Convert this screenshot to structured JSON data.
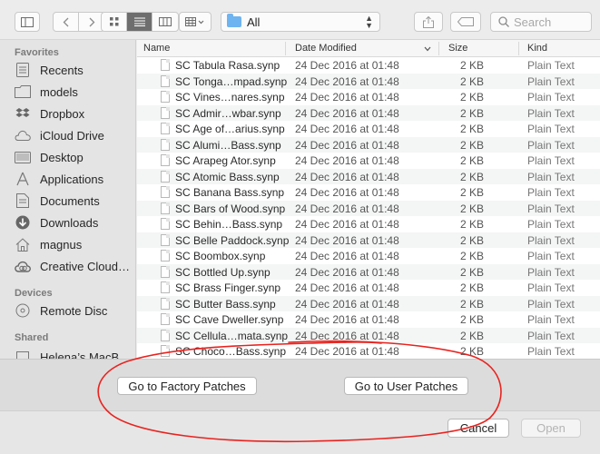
{
  "toolbar": {
    "location": "All",
    "search_placeholder": "Search"
  },
  "sidebar": {
    "sections": [
      {
        "heading": "Favorites"
      },
      {
        "heading": "Devices"
      },
      {
        "heading": "Shared"
      }
    ],
    "favorites": [
      {
        "label": "Recents",
        "icon": "recents-icon"
      },
      {
        "label": "models",
        "icon": "folder-icon"
      },
      {
        "label": "Dropbox",
        "icon": "dropbox-icon"
      },
      {
        "label": "iCloud Drive",
        "icon": "cloud-icon"
      },
      {
        "label": "Desktop",
        "icon": "desktop-icon"
      },
      {
        "label": "Applications",
        "icon": "applications-icon"
      },
      {
        "label": "Documents",
        "icon": "documents-icon"
      },
      {
        "label": "Downloads",
        "icon": "downloads-icon"
      },
      {
        "label": "magnus",
        "icon": "home-icon"
      },
      {
        "label": "Creative Cloud…",
        "icon": "creative-cloud-icon"
      }
    ],
    "devices": [
      {
        "label": "Remote Disc",
        "icon": "disc-icon"
      }
    ],
    "shared": [
      {
        "label": "Helena’s MacB…",
        "icon": "computer-icon"
      }
    ]
  },
  "columns": {
    "name": "Name",
    "date": "Date Modified",
    "size": "Size",
    "kind": "Kind"
  },
  "files": [
    {
      "name": "SC Tabula Rasa.synp",
      "date": "24 Dec 2016 at 01:48",
      "size": "2 KB",
      "kind": "Plain Text"
    },
    {
      "name": "SC Tonga…mpad.synp",
      "date": "24 Dec 2016 at 01:48",
      "size": "2 KB",
      "kind": "Plain Text"
    },
    {
      "name": "SC Vines…nares.synp",
      "date": "24 Dec 2016 at 01:48",
      "size": "2 KB",
      "kind": "Plain Text"
    },
    {
      "name": "SC Admir…wbar.synp",
      "date": "24 Dec 2016 at 01:48",
      "size": "2 KB",
      "kind": "Plain Text"
    },
    {
      "name": "SC Age of…arius.synp",
      "date": "24 Dec 2016 at 01:48",
      "size": "2 KB",
      "kind": "Plain Text"
    },
    {
      "name": "SC Alumi…Bass.synp",
      "date": "24 Dec 2016 at 01:48",
      "size": "2 KB",
      "kind": "Plain Text"
    },
    {
      "name": "SC Arapeg Ator.synp",
      "date": "24 Dec 2016 at 01:48",
      "size": "2 KB",
      "kind": "Plain Text"
    },
    {
      "name": "SC Atomic Bass.synp",
      "date": "24 Dec 2016 at 01:48",
      "size": "2 KB",
      "kind": "Plain Text"
    },
    {
      "name": "SC Banana Bass.synp",
      "date": "24 Dec 2016 at 01:48",
      "size": "2 KB",
      "kind": "Plain Text"
    },
    {
      "name": "SC Bars of Wood.synp",
      "date": "24 Dec 2016 at 01:48",
      "size": "2 KB",
      "kind": "Plain Text"
    },
    {
      "name": "SC Behin…Bass.synp",
      "date": "24 Dec 2016 at 01:48",
      "size": "2 KB",
      "kind": "Plain Text"
    },
    {
      "name": "SC Belle Paddock.synp",
      "date": "24 Dec 2016 at 01:48",
      "size": "2 KB",
      "kind": "Plain Text"
    },
    {
      "name": "SC Boombox.synp",
      "date": "24 Dec 2016 at 01:48",
      "size": "2 KB",
      "kind": "Plain Text"
    },
    {
      "name": "SC Bottled Up.synp",
      "date": "24 Dec 2016 at 01:48",
      "size": "2 KB",
      "kind": "Plain Text"
    },
    {
      "name": "SC Brass Finger.synp",
      "date": "24 Dec 2016 at 01:48",
      "size": "2 KB",
      "kind": "Plain Text"
    },
    {
      "name": "SC Butter Bass.synp",
      "date": "24 Dec 2016 at 01:48",
      "size": "2 KB",
      "kind": "Plain Text"
    },
    {
      "name": "SC Cave Dweller.synp",
      "date": "24 Dec 2016 at 01:48",
      "size": "2 KB",
      "kind": "Plain Text"
    },
    {
      "name": "SC Cellula…mata.synp",
      "date": "24 Dec 2016 at 01:48",
      "size": "2 KB",
      "kind": "Plain Text"
    },
    {
      "name": "SC Choco…Bass.synp",
      "date": "24 Dec 2016 at 01:48",
      "size": "2 KB",
      "kind": "Plain Text"
    }
  ],
  "accessory": {
    "factory_label": "Go to Factory Patches",
    "user_label": "Go to User Patches"
  },
  "footer": {
    "cancel_label": "Cancel",
    "open_label": "Open"
  },
  "colors": {
    "annotation": "#e8231f",
    "folder_accent": "#6eb4f0"
  }
}
